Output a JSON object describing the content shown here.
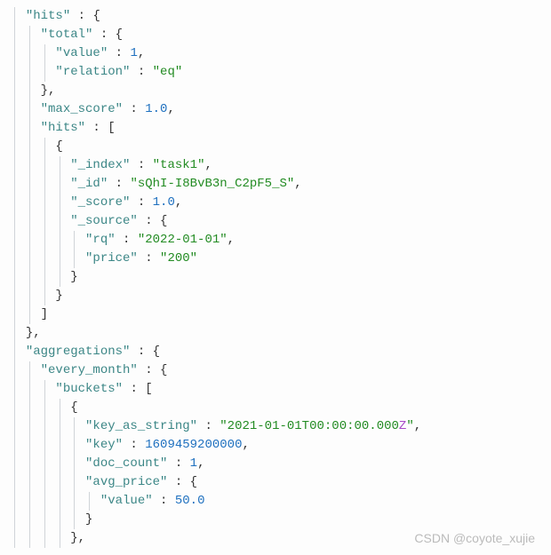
{
  "json_display": {
    "hits_key": "\"hits\"",
    "total_key": "\"total\"",
    "value_key": "\"value\"",
    "relation_key": "\"relation\"",
    "max_score_key": "\"max_score\"",
    "inner_hits_key": "\"hits\"",
    "index_key": "\"_index\"",
    "id_key": "\"_id\"",
    "score_key": "\"_score\"",
    "source_key": "\"_source\"",
    "rq_key": "\"rq\"",
    "price_key": "\"price\"",
    "aggregations_key": "\"aggregations\"",
    "every_month_key": "\"every_month\"",
    "buckets_key": "\"buckets\"",
    "key_as_string_key": "\"key_as_string\"",
    "key_key": "\"key\"",
    "doc_count_key": "\"doc_count\"",
    "avg_price_key": "\"avg_price\"",
    "inner_value_key": "\"value\"",
    "total_value": "1",
    "relation_value": "\"eq\"",
    "max_score_value": "1.0",
    "index_value": "\"task1\"",
    "id_value": "\"sQhI-I8BvB3n_C2pF5_S\"",
    "score_value": "1.0",
    "rq_value": "\"2022-01-01\"",
    "price_value": "\"200\"",
    "key_as_string_value_prefix": "\"2021-01-01T00:00:00.000",
    "key_as_string_value_z": "Z",
    "key_as_string_value_suffix": "\"",
    "key_value": "1609459200000",
    "doc_count_value": "1",
    "avg_price_value": "50.0"
  },
  "watermark": "CSDN @coyote_xujie"
}
